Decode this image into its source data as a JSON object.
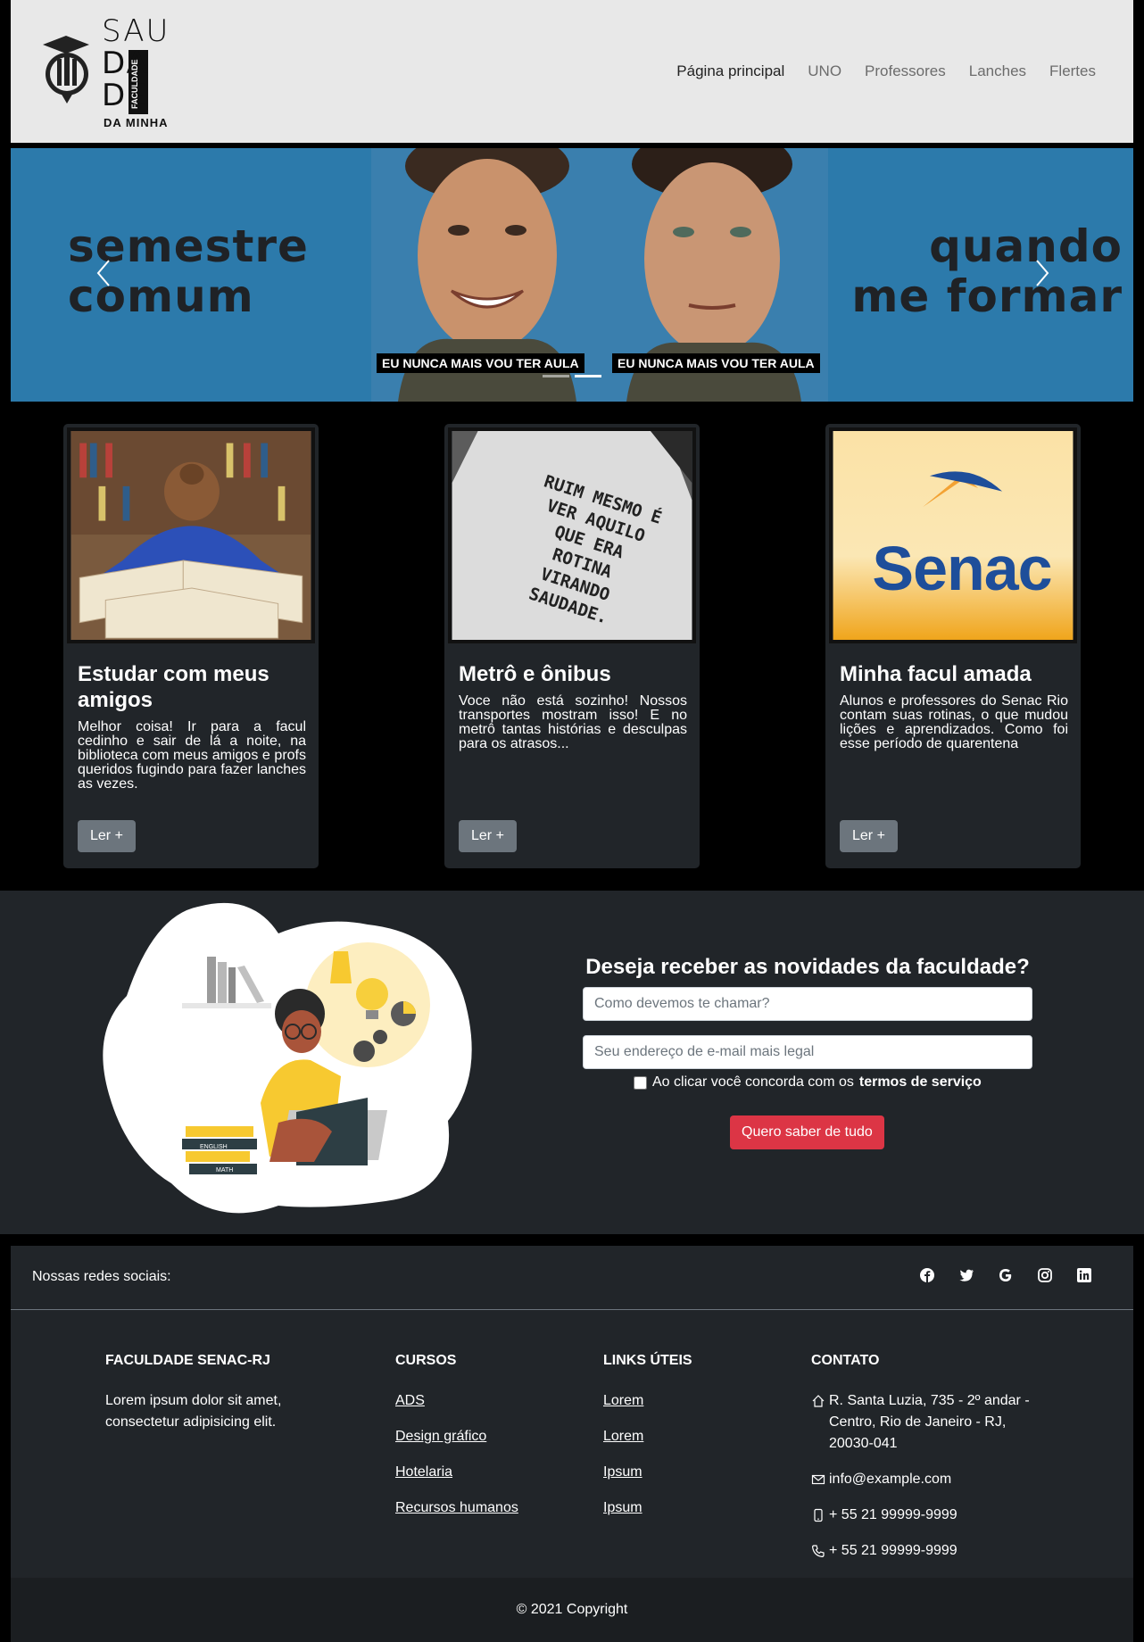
{
  "logo": {
    "line1": "SAU",
    "line2": "DA",
    "line3": "DE",
    "vertical": "FACULDADE",
    "bottom": "DA MINHA"
  },
  "nav": {
    "items": [
      {
        "label": "Página principal",
        "active": true
      },
      {
        "label": "UNO",
        "active": false
      },
      {
        "label": "Professores",
        "active": false
      },
      {
        "label": "Lanches",
        "active": false
      },
      {
        "label": "Flertes",
        "active": false
      }
    ]
  },
  "carousel": {
    "left_text_1": "semestre",
    "left_text_2": "comum",
    "right_text_1": "quando",
    "right_text_2": "me formar",
    "caption_left": "EU NUNCA MAIS VOU TER AULA",
    "caption_right": "EU NUNCA MAIS VOU TER AULA",
    "active_slide": 2,
    "slide_count": 2
  },
  "cards": [
    {
      "title": "Estudar com meus amigos",
      "text": "Melhor coisa! Ir para a facul cedinho e sair de lá a noite, na biblioteca com meus amigos e profs queridos fugindo para fazer lanches as vezes.",
      "button": "Ler +"
    },
    {
      "title": "Metrô e ônibus",
      "text": "Voce não está sozinho! Nossos transportes mostram isso! E no metrô tantas histórias e desculpas para os atrasos...",
      "button": "Ler +",
      "image_text": "RUIM MESMO É VER AQUILO QUE ERA ROTINA VIRANDO SAUDADE."
    },
    {
      "title": "Minha facul amada",
      "text": "Alunos e professores do Senac Rio contam suas rotinas, o que mudou lições e aprendizados. Como foi esse período de quarentena",
      "button": "Ler +",
      "image_text": "Senac"
    }
  ],
  "newsletter": {
    "title": "Deseja receber as novidades da faculdade?",
    "name_placeholder": "Como devemos te chamar?",
    "email_placeholder": "Seu endereço de e-mail mais legal",
    "terms_prefix": "Ao clicar você concorda com os",
    "terms_link": "termos de serviço",
    "button": "Quero saber de tudo",
    "illustration_labels": [
      "ENGLISH",
      "MATH"
    ]
  },
  "footer": {
    "social_label": "Nossas redes sociais:",
    "social_icons": [
      "facebook-icon",
      "twitter-icon",
      "google-icon",
      "instagram-icon",
      "linkedin-icon"
    ],
    "about": {
      "heading": "FACULDADE SENAC-RJ",
      "text": "Lorem ipsum dolor sit amet, consectetur adipisicing elit."
    },
    "courses": {
      "heading": "CURSOS",
      "items": [
        "ADS",
        "Design gráfico",
        "Hotelaria",
        "Recursos humanos"
      ]
    },
    "links": {
      "heading": "LINKS ÚTEIS",
      "items": [
        "Lorem",
        "Lorem",
        "Ipsum",
        "Ipsum"
      ]
    },
    "contact": {
      "heading": "CONTATO",
      "address": "R. Santa Luzia, 735 - 2º andar - Centro, Rio de Janeiro - RJ, 20030-041",
      "email": "info@example.com",
      "mobile": "+ 55 21 99999-9999",
      "phone": "+ 55 21 99999-9999"
    },
    "copyright": "© 2021 Copyright"
  }
}
